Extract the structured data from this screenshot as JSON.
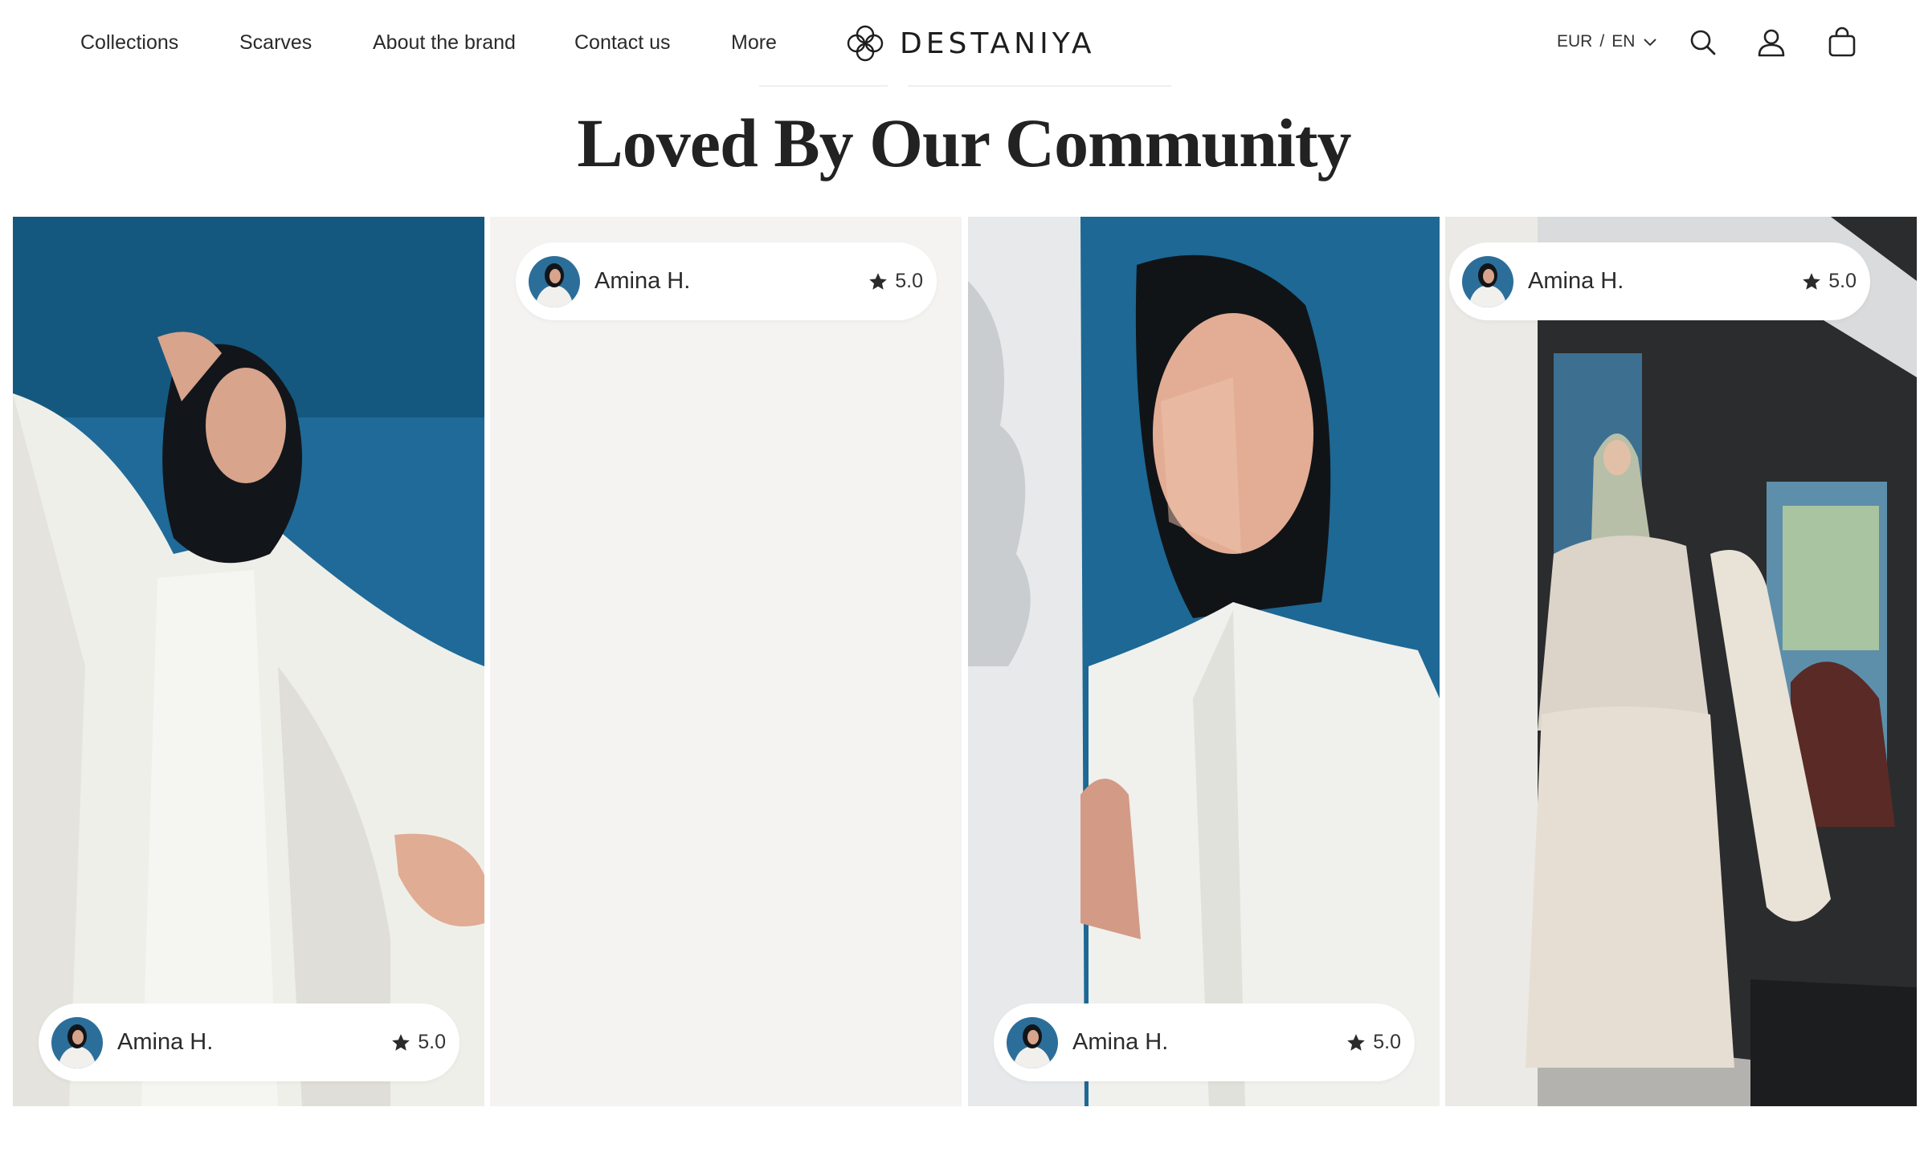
{
  "header": {
    "nav": [
      {
        "label": "Collections"
      },
      {
        "label": "Scarves"
      },
      {
        "label": "About the brand"
      },
      {
        "label": "Contact us"
      },
      {
        "label": "More"
      }
    ],
    "brand": "DESTANIYA",
    "currency": "EUR",
    "locale_separator": "/",
    "language": "EN",
    "icons": [
      "search-icon",
      "account-icon",
      "cart-icon",
      "chevron-down-icon"
    ]
  },
  "section": {
    "title": "Loved By Our Community"
  },
  "reviews": [
    {
      "name": "Amina H.",
      "rating": "5.0",
      "position": "bottom",
      "photo": "woman in white shirt and black hijab against blue sky"
    },
    {
      "name": "Amina H.",
      "rating": "5.0",
      "position": "top",
      "photo": "blank light beige panel"
    },
    {
      "name": "Amina H.",
      "rating": "5.0",
      "position": "bottom",
      "photo": "close-up of woman in black hijab by white wall"
    },
    {
      "name": "Amina H.",
      "rating": "5.0",
      "position": "top",
      "photo": "woman in beige set and sage hijab by building"
    }
  ],
  "colors": {
    "sky": "#1f6a98",
    "panel": "#f4f3f1",
    "text": "#222222"
  }
}
